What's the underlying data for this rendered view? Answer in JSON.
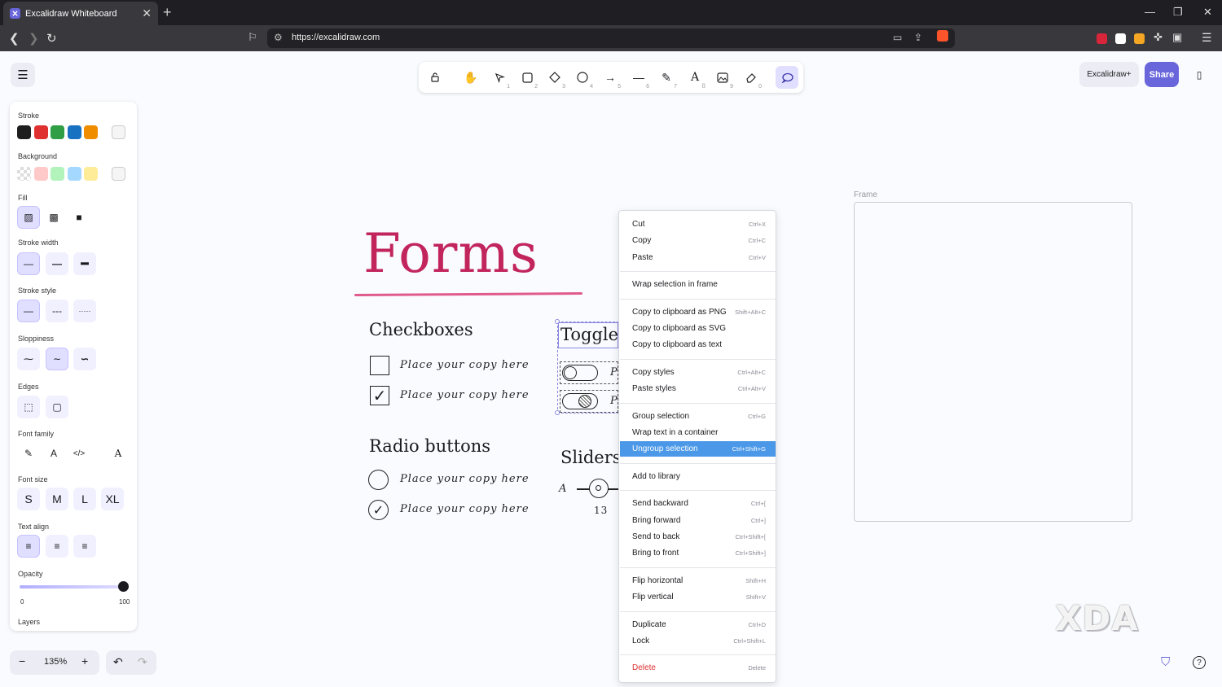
{
  "browser": {
    "tab_title": "Excalidraw Whiteboard",
    "url": "https://excalidraw.com"
  },
  "toolbar": {
    "tools": [
      {
        "icon": "lock-icon",
        "key": ""
      },
      {
        "icon": "hand-icon",
        "key": ""
      },
      {
        "icon": "selection-icon",
        "key": "1"
      },
      {
        "icon": "rectangle-icon",
        "key": "2"
      },
      {
        "icon": "diamond-icon",
        "key": "3"
      },
      {
        "icon": "ellipse-icon",
        "key": "4"
      },
      {
        "icon": "arrow-icon",
        "key": "5"
      },
      {
        "icon": "line-icon",
        "key": "6"
      },
      {
        "icon": "pencil-icon",
        "key": "7"
      },
      {
        "icon": "text-icon",
        "key": "8"
      },
      {
        "icon": "image-icon",
        "key": "9"
      },
      {
        "icon": "eraser-icon",
        "key": "0"
      },
      {
        "icon": "comment-icon",
        "key": ""
      }
    ],
    "excalidraw_plus": "Excalidraw+",
    "share": "Share"
  },
  "properties": {
    "stroke_label": "Stroke",
    "stroke_colors": [
      "#1e1e1e",
      "#e03131",
      "#2f9e44",
      "#1971c2",
      "#f08c00"
    ],
    "background_label": "Background",
    "background_colors": [
      "transparent",
      "#ffc9c9",
      "#b2f2bb",
      "#a5d8ff",
      "#ffec99"
    ],
    "fill_label": "Fill",
    "stroke_width_label": "Stroke width",
    "stroke_style_label": "Stroke style",
    "sloppiness_label": "Sloppiness",
    "edges_label": "Edges",
    "font_family_label": "Font family",
    "font_size_label": "Font size",
    "font_sizes": [
      "S",
      "M",
      "L",
      "XL"
    ],
    "text_align_label": "Text align",
    "opacity_label": "Opacity",
    "opacity_min": "0",
    "opacity_max": "100",
    "opacity_value": 100,
    "layers_label": "Layers"
  },
  "zoom": {
    "level": "135%"
  },
  "canvas": {
    "title": "Forms",
    "checkboxes_heading": "Checkboxes",
    "radio_heading": "Radio buttons",
    "toggle_heading": "Toggle",
    "sliders_heading": "Sliders",
    "copy_text": "Place your copy here",
    "slider_a": "A",
    "slider_value": "13",
    "toggle_p": "P",
    "frame_label": "Frame"
  },
  "context_menu": {
    "groups": [
      [
        {
          "label": "Cut",
          "shortcut": "Ctrl+X"
        },
        {
          "label": "Copy",
          "shortcut": "Ctrl+C"
        },
        {
          "label": "Paste",
          "shortcut": "Ctrl+V"
        }
      ],
      [
        {
          "label": "Wrap selection in frame",
          "shortcut": ""
        }
      ],
      [
        {
          "label": "Copy to clipboard as PNG",
          "shortcut": "Shift+Alt+C"
        },
        {
          "label": "Copy to clipboard as SVG",
          "shortcut": ""
        },
        {
          "label": "Copy to clipboard as text",
          "shortcut": ""
        }
      ],
      [
        {
          "label": "Copy styles",
          "shortcut": "Ctrl+Alt+C"
        },
        {
          "label": "Paste styles",
          "shortcut": "Ctrl+Alt+V"
        }
      ],
      [
        {
          "label": "Group selection",
          "shortcut": "Ctrl+G"
        },
        {
          "label": "Wrap text in a container",
          "shortcut": ""
        },
        {
          "label": "Ungroup selection",
          "shortcut": "Ctrl+Shift+G",
          "highlighted": true
        }
      ],
      [
        {
          "label": "Add to library",
          "shortcut": ""
        }
      ],
      [
        {
          "label": "Send backward",
          "shortcut": "Ctrl+["
        },
        {
          "label": "Bring forward",
          "shortcut": "Ctrl+]"
        },
        {
          "label": "Send to back",
          "shortcut": "Ctrl+Shift+["
        },
        {
          "label": "Bring to front",
          "shortcut": "Ctrl+Shift+]"
        }
      ],
      [
        {
          "label": "Flip horizontal",
          "shortcut": "Shift+H"
        },
        {
          "label": "Flip vertical",
          "shortcut": "Shift+V"
        }
      ],
      [
        {
          "label": "Duplicate",
          "shortcut": "Ctrl+D"
        },
        {
          "label": "Lock",
          "shortcut": "Ctrl+Shift+L"
        }
      ],
      [
        {
          "label": "Delete",
          "shortcut": "Delete",
          "danger": true
        }
      ]
    ]
  },
  "watermark": "XDA"
}
